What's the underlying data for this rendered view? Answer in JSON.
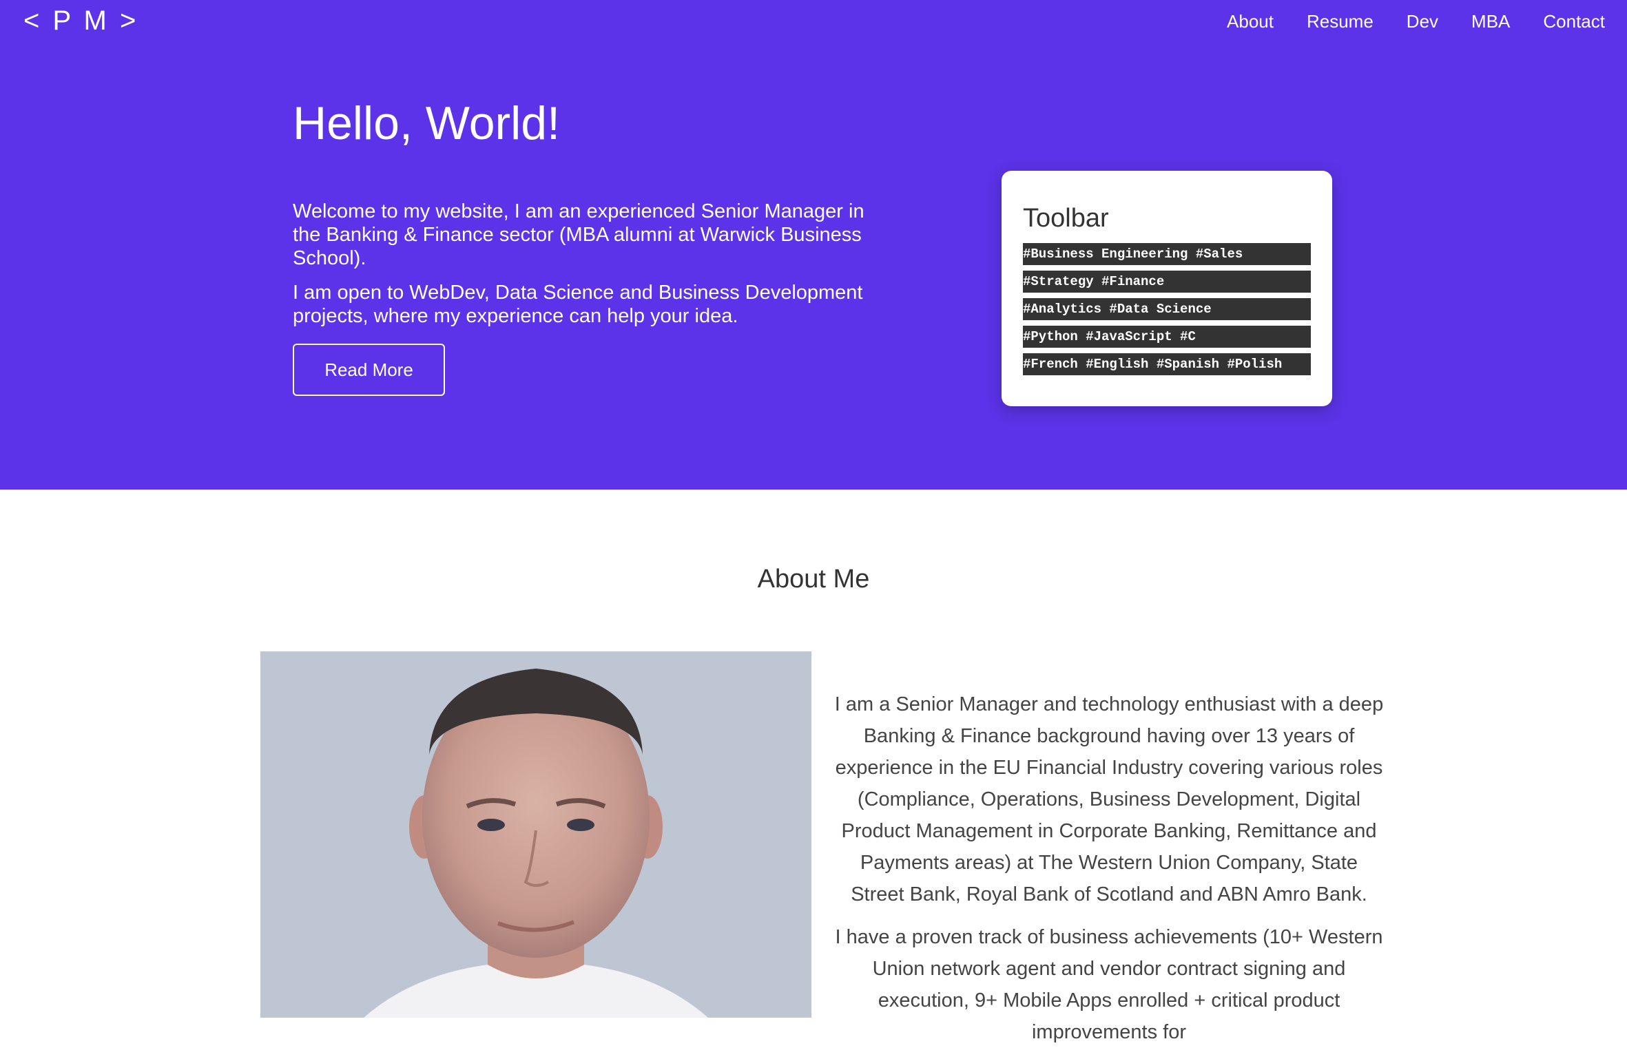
{
  "header": {
    "logo": "< P M >",
    "nav": [
      "About",
      "Resume",
      "Dev",
      "MBA",
      "Contact"
    ]
  },
  "hero": {
    "title": "Hello, World!",
    "paragraphs": [
      "Welcome to my website, I am an experienced Senior Manager in the Banking & Finance sector (MBA alumni at Warwick Business School).",
      "I am open to WebDev, Data Science and Business Development projects, where my experience can help your idea."
    ],
    "button_label": "Read More"
  },
  "toolbar": {
    "title": "Toolbar",
    "tags": [
      "#Business Engineering #Sales",
      "#Strategy #Finance",
      "#Analytics #Data Science",
      "#Python #JavaScript #C",
      "#French #English #Spanish #Polish"
    ]
  },
  "about": {
    "title": "About Me",
    "paragraphs": [
      "I am a Senior Manager and technology enthusiast with a deep Banking & Finance background having over 13 years of experience in the EU Financial Industry covering various roles (Compliance, Operations, Business Development, Digital Product Management in Corporate Banking, Remittance and Payments areas) at The Western Union Company, State Street Bank, Royal Bank of Scotland and ABN Amro Bank.",
      "I have a proven track of business achievements (10+ Western Union network agent and vendor contract signing and execution, 9+ Mobile Apps enrolled + critical product improvements for"
    ]
  },
  "colors": {
    "hero_background": "#5c33e8",
    "tag_background": "#333333"
  }
}
